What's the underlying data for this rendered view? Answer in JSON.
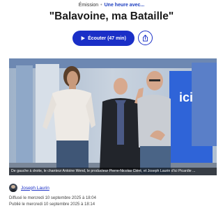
{
  "breadcrumb": {
    "type": "Émission",
    "separator": "•",
    "show": "Une heure avec..."
  },
  "title": "\"Balavoine, ma Bataille\"",
  "listen_button": {
    "label": "Écouter (47 min)",
    "icon": "play-icon"
  },
  "share_button": {
    "icon": "share-icon"
  },
  "photo": {
    "caption": "De gauche à droite, le chanteur Antoine Wend, le producteur Pierre-Nicolas Cléré, et Joseph Laurin d'ici Picardie ...",
    "logo_text": "ici"
  },
  "author": {
    "name": "Joseph Laurin"
  },
  "dates": {
    "broadcast": "Diffusé le mercredi 10 septembre 2025 à 18:04",
    "published": "Publié le mercredi 10 septembre 2025 à 18:14"
  },
  "colors": {
    "accent": "#1a2fc7",
    "studio_blue": "#2f64d8"
  }
}
